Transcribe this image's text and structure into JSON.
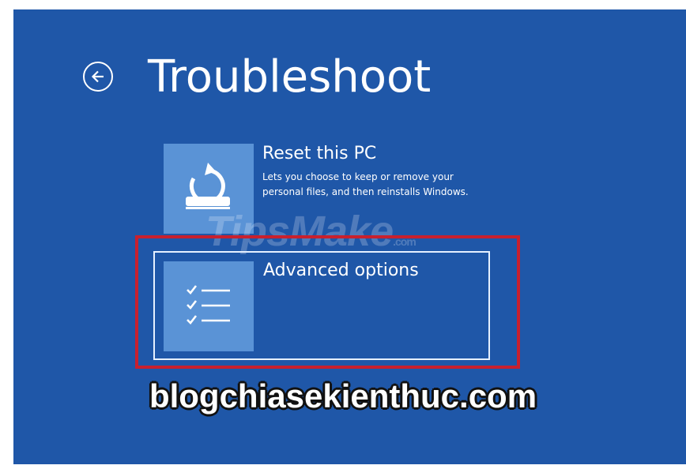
{
  "page": {
    "title": "Troubleshoot",
    "back_icon": "back-arrow-circle-icon"
  },
  "options": [
    {
      "label": "Reset this PC",
      "description": "Lets you choose to keep or remove your personal files, and then reinstalls Windows.",
      "icon": "reset-refresh-icon"
    },
    {
      "label": "Advanced options",
      "description": "",
      "icon": "checklist-icon"
    }
  ],
  "watermark": {
    "brand": "TipsMake",
    "suffix": ".com"
  },
  "caption": "blogchiasekienthuc.com",
  "colors": {
    "background": "#1f57a8",
    "tile": "#5a93d6",
    "highlight": "#c8202e",
    "text": "#ffffff"
  }
}
